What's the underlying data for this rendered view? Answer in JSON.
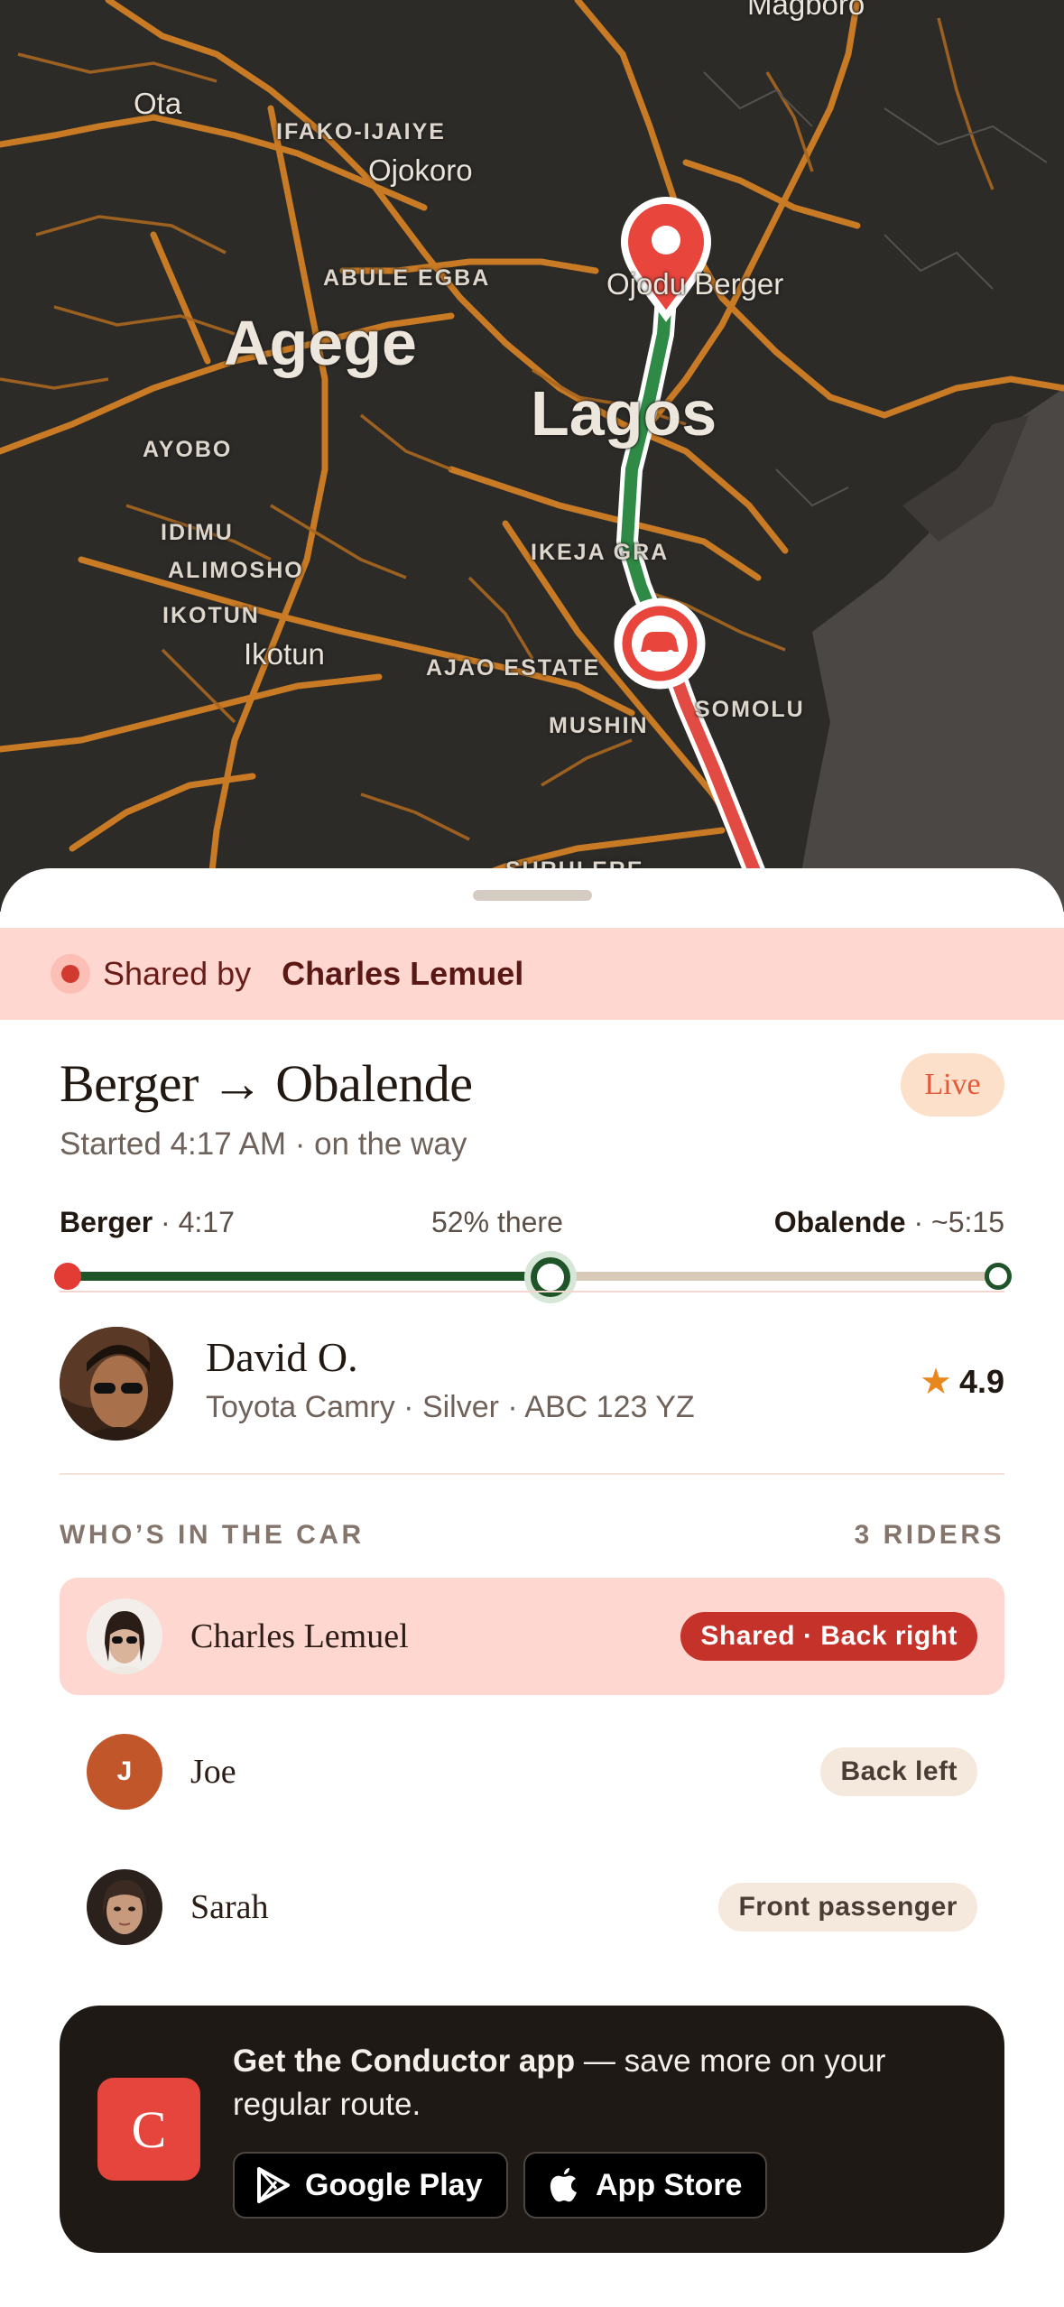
{
  "map": {
    "labels": {
      "magboro": "Magboro",
      "ota": "Ota",
      "ifako": "IFAKO-IJAIYE",
      "ojokoro": "Ojokoro",
      "abule": "ABULE EGBA",
      "ojodu": "Ojodu Berger",
      "agege": "Agege",
      "lagos": "Lagos",
      "ayobo": "AYOBO",
      "idimu": "IDIMU",
      "alimosho": "ALIMOSHO",
      "ikotun_caps": "IKOTUN",
      "ikotun": "Ikotun",
      "ikeja": "IKEJA GRA",
      "ajao": "AJAO ESTATE",
      "mushin": "MUSHIN",
      "somolu": "SOMOLU",
      "surulere": "SURULERE"
    }
  },
  "shared": {
    "label": "Shared by",
    "name": "Charles Lemuel"
  },
  "trip": {
    "title": "Berger → Obalende",
    "subtitle": "Started 4:17 AM · on the way",
    "status": "Live",
    "origin": "Berger",
    "origin_time": "· 4:17",
    "progress_label": "52% there",
    "progress": 0.52,
    "destination": "Obalende",
    "destination_time": "· ~5:15"
  },
  "driver": {
    "name": "David O.",
    "car": "Toyota Camry · Silver · ABC 123 YZ",
    "rating": "4.9"
  },
  "riders": {
    "heading": "WHO’S IN THE CAR",
    "count": "3 RIDERS",
    "list": [
      {
        "name": "Charles Lemuel",
        "seat": "Shared · Back right"
      },
      {
        "name": "Joe",
        "initial": "J",
        "seat": "Back left"
      },
      {
        "name": "Sarah",
        "seat": "Front passenger"
      }
    ]
  },
  "promo": {
    "logo_letter": "C",
    "headline": "Get the Conductor app",
    "body": " — save more on your regular route.",
    "google_play": "Google Play",
    "app_store": "App Store"
  },
  "colors": {
    "accent_red": "#e23c35",
    "route_green": "#2f8a46",
    "progress_green": "#1e5428",
    "shared_bg": "#fdd7d0",
    "live_bg": "#fde0c9",
    "star": "#e8871e"
  }
}
